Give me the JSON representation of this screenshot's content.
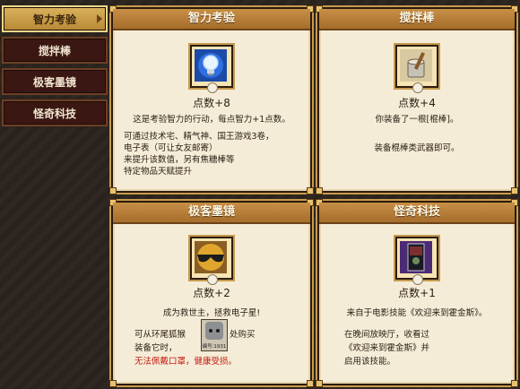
{
  "sidebar": {
    "items": [
      {
        "label": "智力考验",
        "active": true
      },
      {
        "label": "搅拌棒",
        "active": false
      },
      {
        "label": "极客墨镜",
        "active": false
      },
      {
        "label": "怪奇科技",
        "active": false
      }
    ]
  },
  "cards": [
    {
      "title": "智力考验",
      "icon": "light-bulb-icon",
      "points": "点数+8",
      "lines": [
        "这是考验智力的行动，每点智力+1点数。",
        "可通过技术宅、精气神、国王游戏3卷，",
        "电子表（可让女友邮寄）",
        "来提升该数值，另有焦糖棒等",
        "特定物品天赋提升"
      ]
    },
    {
      "title": "搅拌棒",
      "icon": "stirring-stick-icon",
      "points": "点数+4",
      "lines": [
        "你装备了一根[棍棒]。",
        "装备棍棒类武器即可。"
      ]
    },
    {
      "title": "极客墨镜",
      "icon": "sunglasses-icon",
      "points": "点数+2",
      "lines": [
        "成为救世主，拯救电子星!",
        "可从环尾狐猴",
        "处购买",
        "装备它时，",
        "无法佩戴口罩，健康受损。"
      ],
      "npc_tag": "编号:1931"
    },
    {
      "title": "怪奇科技",
      "icon": "movie-card-icon",
      "points": "点数+1",
      "lines": [
        "来自于电影技能《欢迎来到霍金斯》。",
        "在晚间放映厅，收看过",
        "《欢迎来到霍金斯》并",
        "启用该技能。"
      ]
    }
  ]
}
